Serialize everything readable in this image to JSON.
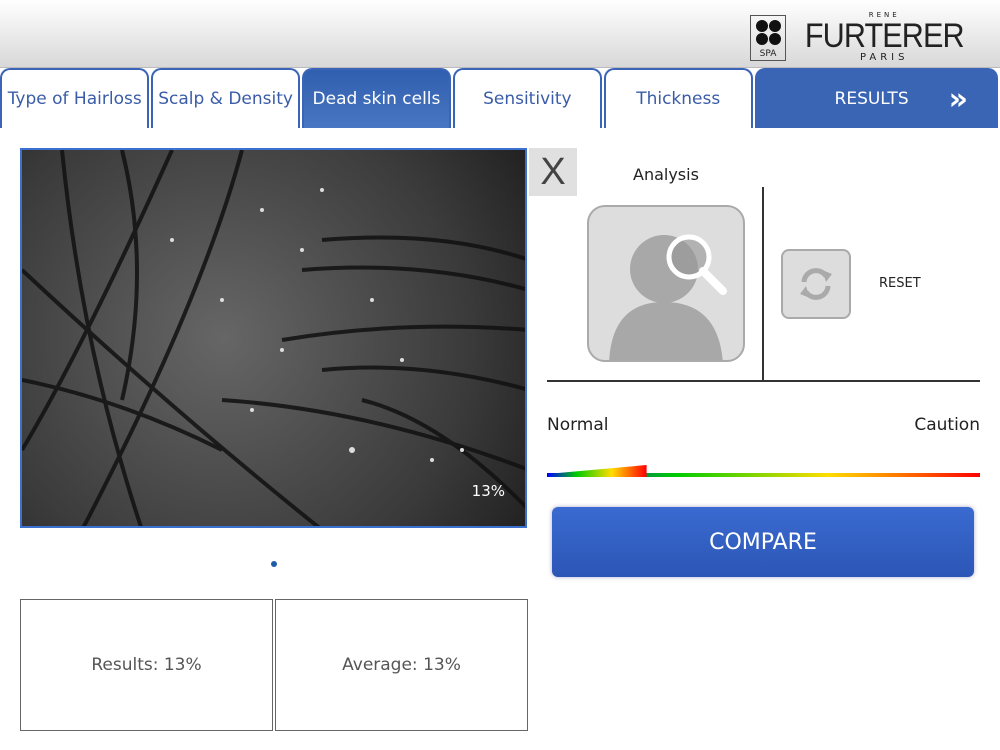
{
  "header": {
    "logo": {
      "top": "RENE",
      "brand": "FURTERER",
      "sub": "PARIS",
      "spa": "SPA"
    }
  },
  "tabs": [
    {
      "label": "Type of Hairloss"
    },
    {
      "label": "Scalp & Density"
    },
    {
      "label": "Dead skin cells",
      "active": true
    },
    {
      "label": "Sensitivity"
    },
    {
      "label": "Thickness"
    },
    {
      "label": "RESULTS",
      "icon": "double-chevron-right-icon"
    }
  ],
  "image": {
    "overlay_percent": "13%",
    "page_indicator": "1 of 1"
  },
  "close_label": "X",
  "analysis": {
    "label": "Analysis",
    "icon": "user-magnifier-icon"
  },
  "reset": {
    "label": "RESET",
    "icon": "refresh-icon"
  },
  "gauge": {
    "left_label": "Normal",
    "right_label": "Caution",
    "level": 0.23,
    "colors": [
      "#0000ff",
      "#00cc00",
      "#ffff00",
      "#ff0000"
    ]
  },
  "compare_label": "COMPARE",
  "results": {
    "results_label": "Results: 13%",
    "average_label": "Average: 13%"
  }
}
